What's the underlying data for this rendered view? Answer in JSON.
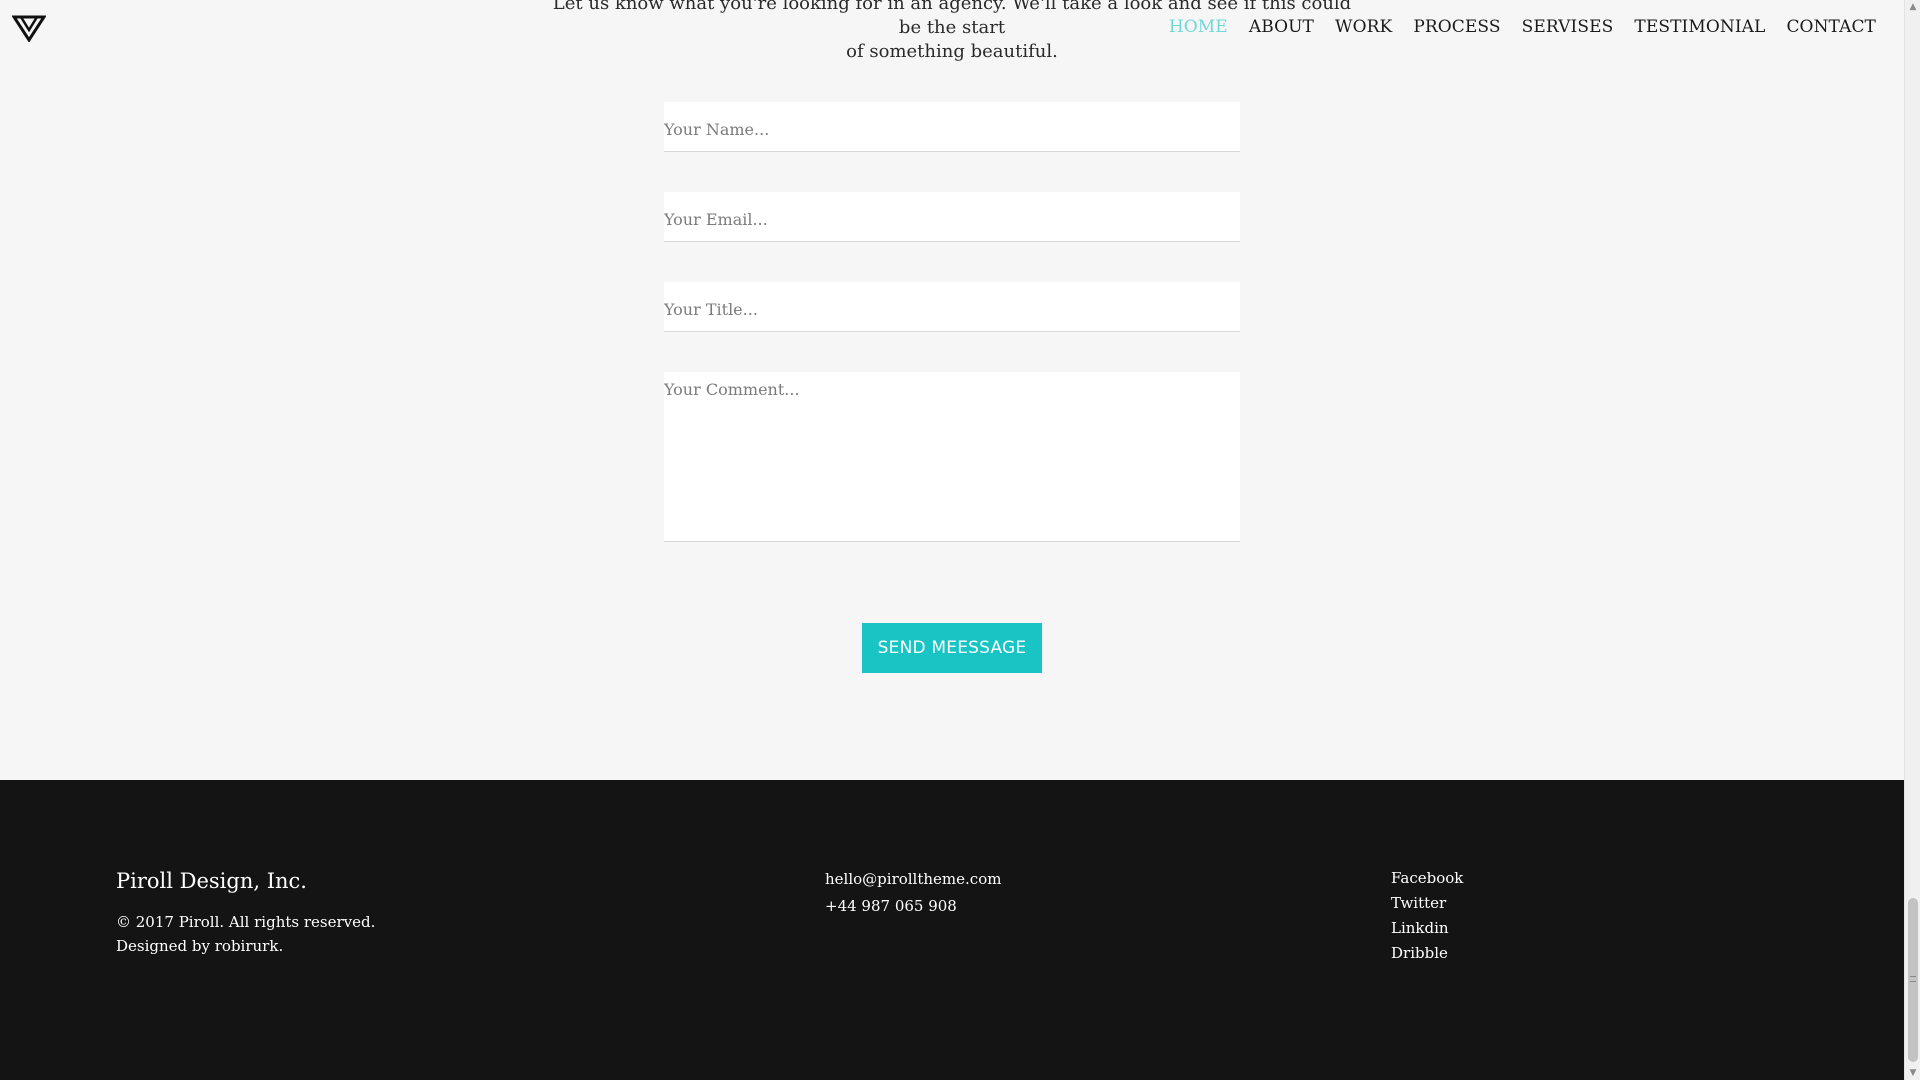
{
  "header": {
    "logo_icon": "triangle-logo-icon",
    "intro_line1": "Let us know what you're looking for in an agency. We'll take a look and see if this could be the start",
    "intro_line2": "of something beautiful.",
    "nav": [
      {
        "label": "HOME",
        "active": true
      },
      {
        "label": "ABOUT",
        "active": false
      },
      {
        "label": "WORK",
        "active": false
      },
      {
        "label": "PROCESS",
        "active": false
      },
      {
        "label": "SERVISES",
        "active": false
      },
      {
        "label": "TESTIMONIAL",
        "active": false
      },
      {
        "label": "CONTACT",
        "active": false
      }
    ],
    "nav_active_color": "#6fd8d8"
  },
  "form": {
    "name_placeholder": "Your Name...",
    "email_placeholder": "Your Email...",
    "title_placeholder": "Your Title...",
    "comment_placeholder": "Your Comment...",
    "name_value": "",
    "email_value": "",
    "title_value": "",
    "comment_value": "",
    "send_label": "SEND MEESSAGE",
    "accent_color": "#19c4c4"
  },
  "footer": {
    "company": "Piroll Design, Inc.",
    "copyright": "© 2017 Piroll. All rights reserved.",
    "designed_by": "Designed by robirurk.",
    "email": "hello@pirolltheme.com",
    "phone": "+44 987 065 908",
    "social": [
      "Facebook",
      "Twitter",
      "Linkdin",
      "Dribble"
    ],
    "background_color": "#141414"
  }
}
